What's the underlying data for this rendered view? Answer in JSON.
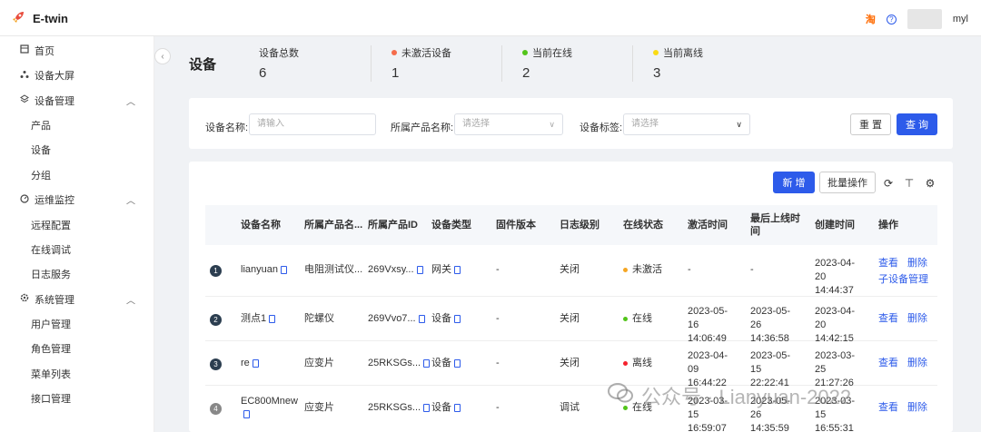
{
  "app": {
    "title": "E-twin"
  },
  "header": {
    "username": "myl",
    "icon_left": "taobao-icon",
    "icon_help": "help-icon"
  },
  "sidebar": {
    "items": [
      {
        "label": "首页",
        "icon": "home-icon",
        "level": 1
      },
      {
        "label": "设备大屏",
        "icon": "cluster-icon",
        "level": 1
      },
      {
        "label": "设备管理",
        "icon": "layers-icon",
        "level": 1,
        "expanded": true
      },
      {
        "label": "产品",
        "level": 2
      },
      {
        "label": "设备",
        "level": 2
      },
      {
        "label": "分组",
        "level": 2
      },
      {
        "label": "运维监控",
        "icon": "dashboard-icon",
        "level": 1,
        "expanded": true
      },
      {
        "label": "远程配置",
        "level": 2
      },
      {
        "label": "在线调试",
        "level": 2
      },
      {
        "label": "日志服务",
        "level": 2
      },
      {
        "label": "系统管理",
        "icon": "gear-icon",
        "level": 1,
        "expanded": true
      },
      {
        "label": "用户管理",
        "level": 2
      },
      {
        "label": "角色管理",
        "level": 2
      },
      {
        "label": "菜单列表",
        "level": 2
      },
      {
        "label": "接口管理",
        "level": 2
      }
    ]
  },
  "page": {
    "title": "设备"
  },
  "stats": [
    {
      "label": "设备总数",
      "value": "6",
      "dot": ""
    },
    {
      "label": "未激活设备",
      "value": "1",
      "dot": "#f56c4b"
    },
    {
      "label": "当前在线",
      "value": "2",
      "dot": "#52c41a"
    },
    {
      "label": "当前离线",
      "value": "3",
      "dot": "#fadb14"
    }
  ],
  "filters": {
    "device_name_label": "设备名称:",
    "device_name_placeholder": "请输入",
    "product_label": "所属产品名称:",
    "product_placeholder": "请选择",
    "tag_label": "设备标签:",
    "tag_placeholder": "请选择",
    "reset": "重 置",
    "query": "查 询"
  },
  "toolbar": {
    "add": "新 增",
    "batch": "批量操作"
  },
  "table": {
    "headers": [
      "设备名称",
      "所属产品名...",
      "所属产品ID",
      "设备类型",
      "固件版本",
      "日志级别",
      "在线状态",
      "激活时间",
      "最后上线时间",
      "创建时间",
      "操作"
    ],
    "rows": [
      {
        "idx": "1",
        "name": "lianyuan",
        "product": "电阻测试仪...",
        "product_id": "269Vxsy...",
        "type": "网关",
        "firmware": "-",
        "log": "关闭",
        "status": "未激活",
        "status_color": "#f5a623",
        "activated": "-",
        "last_online": "-",
        "created": "2023-04-20 14:44:37",
        "actions": [
          "查看",
          "删除",
          "子设备管理"
        ]
      },
      {
        "idx": "2",
        "name": "测点1",
        "product": "陀螺仪",
        "product_id": "269Vvo7...",
        "type": "设备",
        "firmware": "-",
        "log": "关闭",
        "status": "在线",
        "status_color": "#52c41a",
        "activated": "2023-05-16 14:06:49",
        "last_online": "2023-05-26 14:36:58",
        "created": "2023-04-20 14:42:15",
        "actions": [
          "查看",
          "删除"
        ]
      },
      {
        "idx": "3",
        "name": "re",
        "product": "应变片",
        "product_id": "25RKSGs...",
        "type": "设备",
        "firmware": "-",
        "log": "关闭",
        "status": "离线",
        "status_color": "#f5222d",
        "activated": "2023-04-09 16:44:22",
        "last_online": "2023-05-15 22:22:41",
        "created": "2023-03-25 21:27:26",
        "actions": [
          "查看",
          "删除"
        ]
      },
      {
        "idx": "4",
        "name": "EC800Mnew",
        "product": "应变片",
        "product_id": "25RKSGs...",
        "type": "设备",
        "firmware": "-",
        "log": "调试",
        "status": "在线",
        "status_color": "#52c41a",
        "activated": "2023-03-15 16:59:07",
        "last_online": "2023-05-26 14:35:59",
        "created": "2023-03-15 16:55:31",
        "actions": [
          "查看",
          "删除"
        ]
      }
    ]
  },
  "watermark": {
    "text": "公众号 · Lianyuan-2022"
  }
}
